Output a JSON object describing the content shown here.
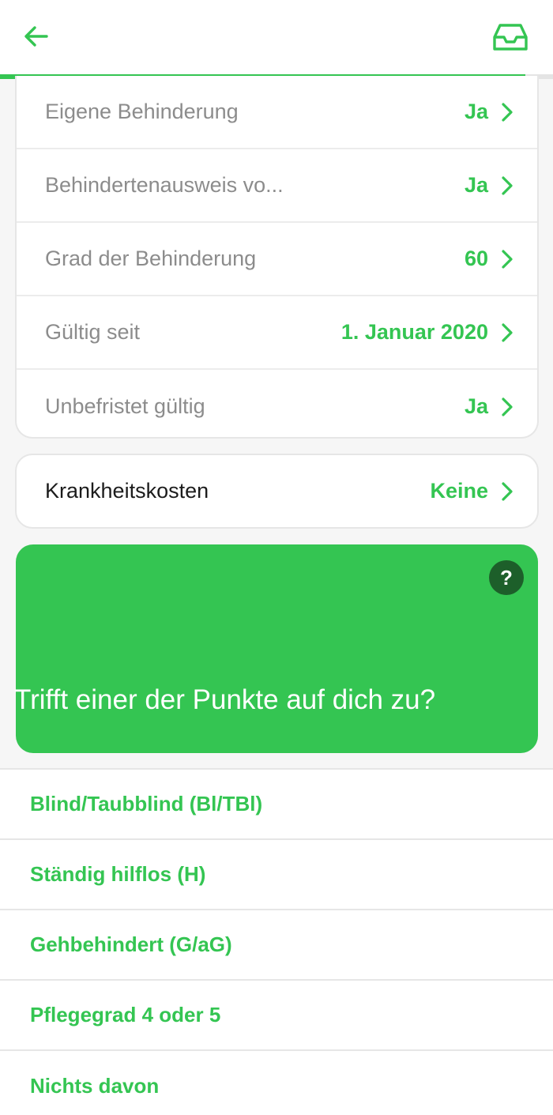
{
  "header": {
    "back_icon": "arrow-left-icon",
    "inbox_icon": "inbox-tray-icon",
    "progress": 0.95,
    "accent_color": "#34c552"
  },
  "disability_card": {
    "rows": [
      {
        "label": "Eigene Behinderung",
        "value": "Ja"
      },
      {
        "label": "Behindertenausweis vo...",
        "value": "Ja"
      },
      {
        "label": "Grad der Behinderung",
        "value": "60"
      },
      {
        "label": "Gültig seit",
        "value": "1. Januar 2020"
      },
      {
        "label": "Unbefristet gültig",
        "value": "Ja"
      }
    ]
  },
  "costs_card": {
    "label": "Krankheitskosten",
    "value": "Keine"
  },
  "question": {
    "help_label": "?",
    "title": "Trifft einer der Punkte auf dich zu?"
  },
  "options": [
    {
      "label": "Blind/Taubblind (Bl/TBl)"
    },
    {
      "label": "Ständig hilflos (H)"
    },
    {
      "label": "Gehbehindert (G/aG)"
    },
    {
      "label": "Pflegegrad 4 oder 5"
    },
    {
      "label": "Nichts davon"
    }
  ]
}
